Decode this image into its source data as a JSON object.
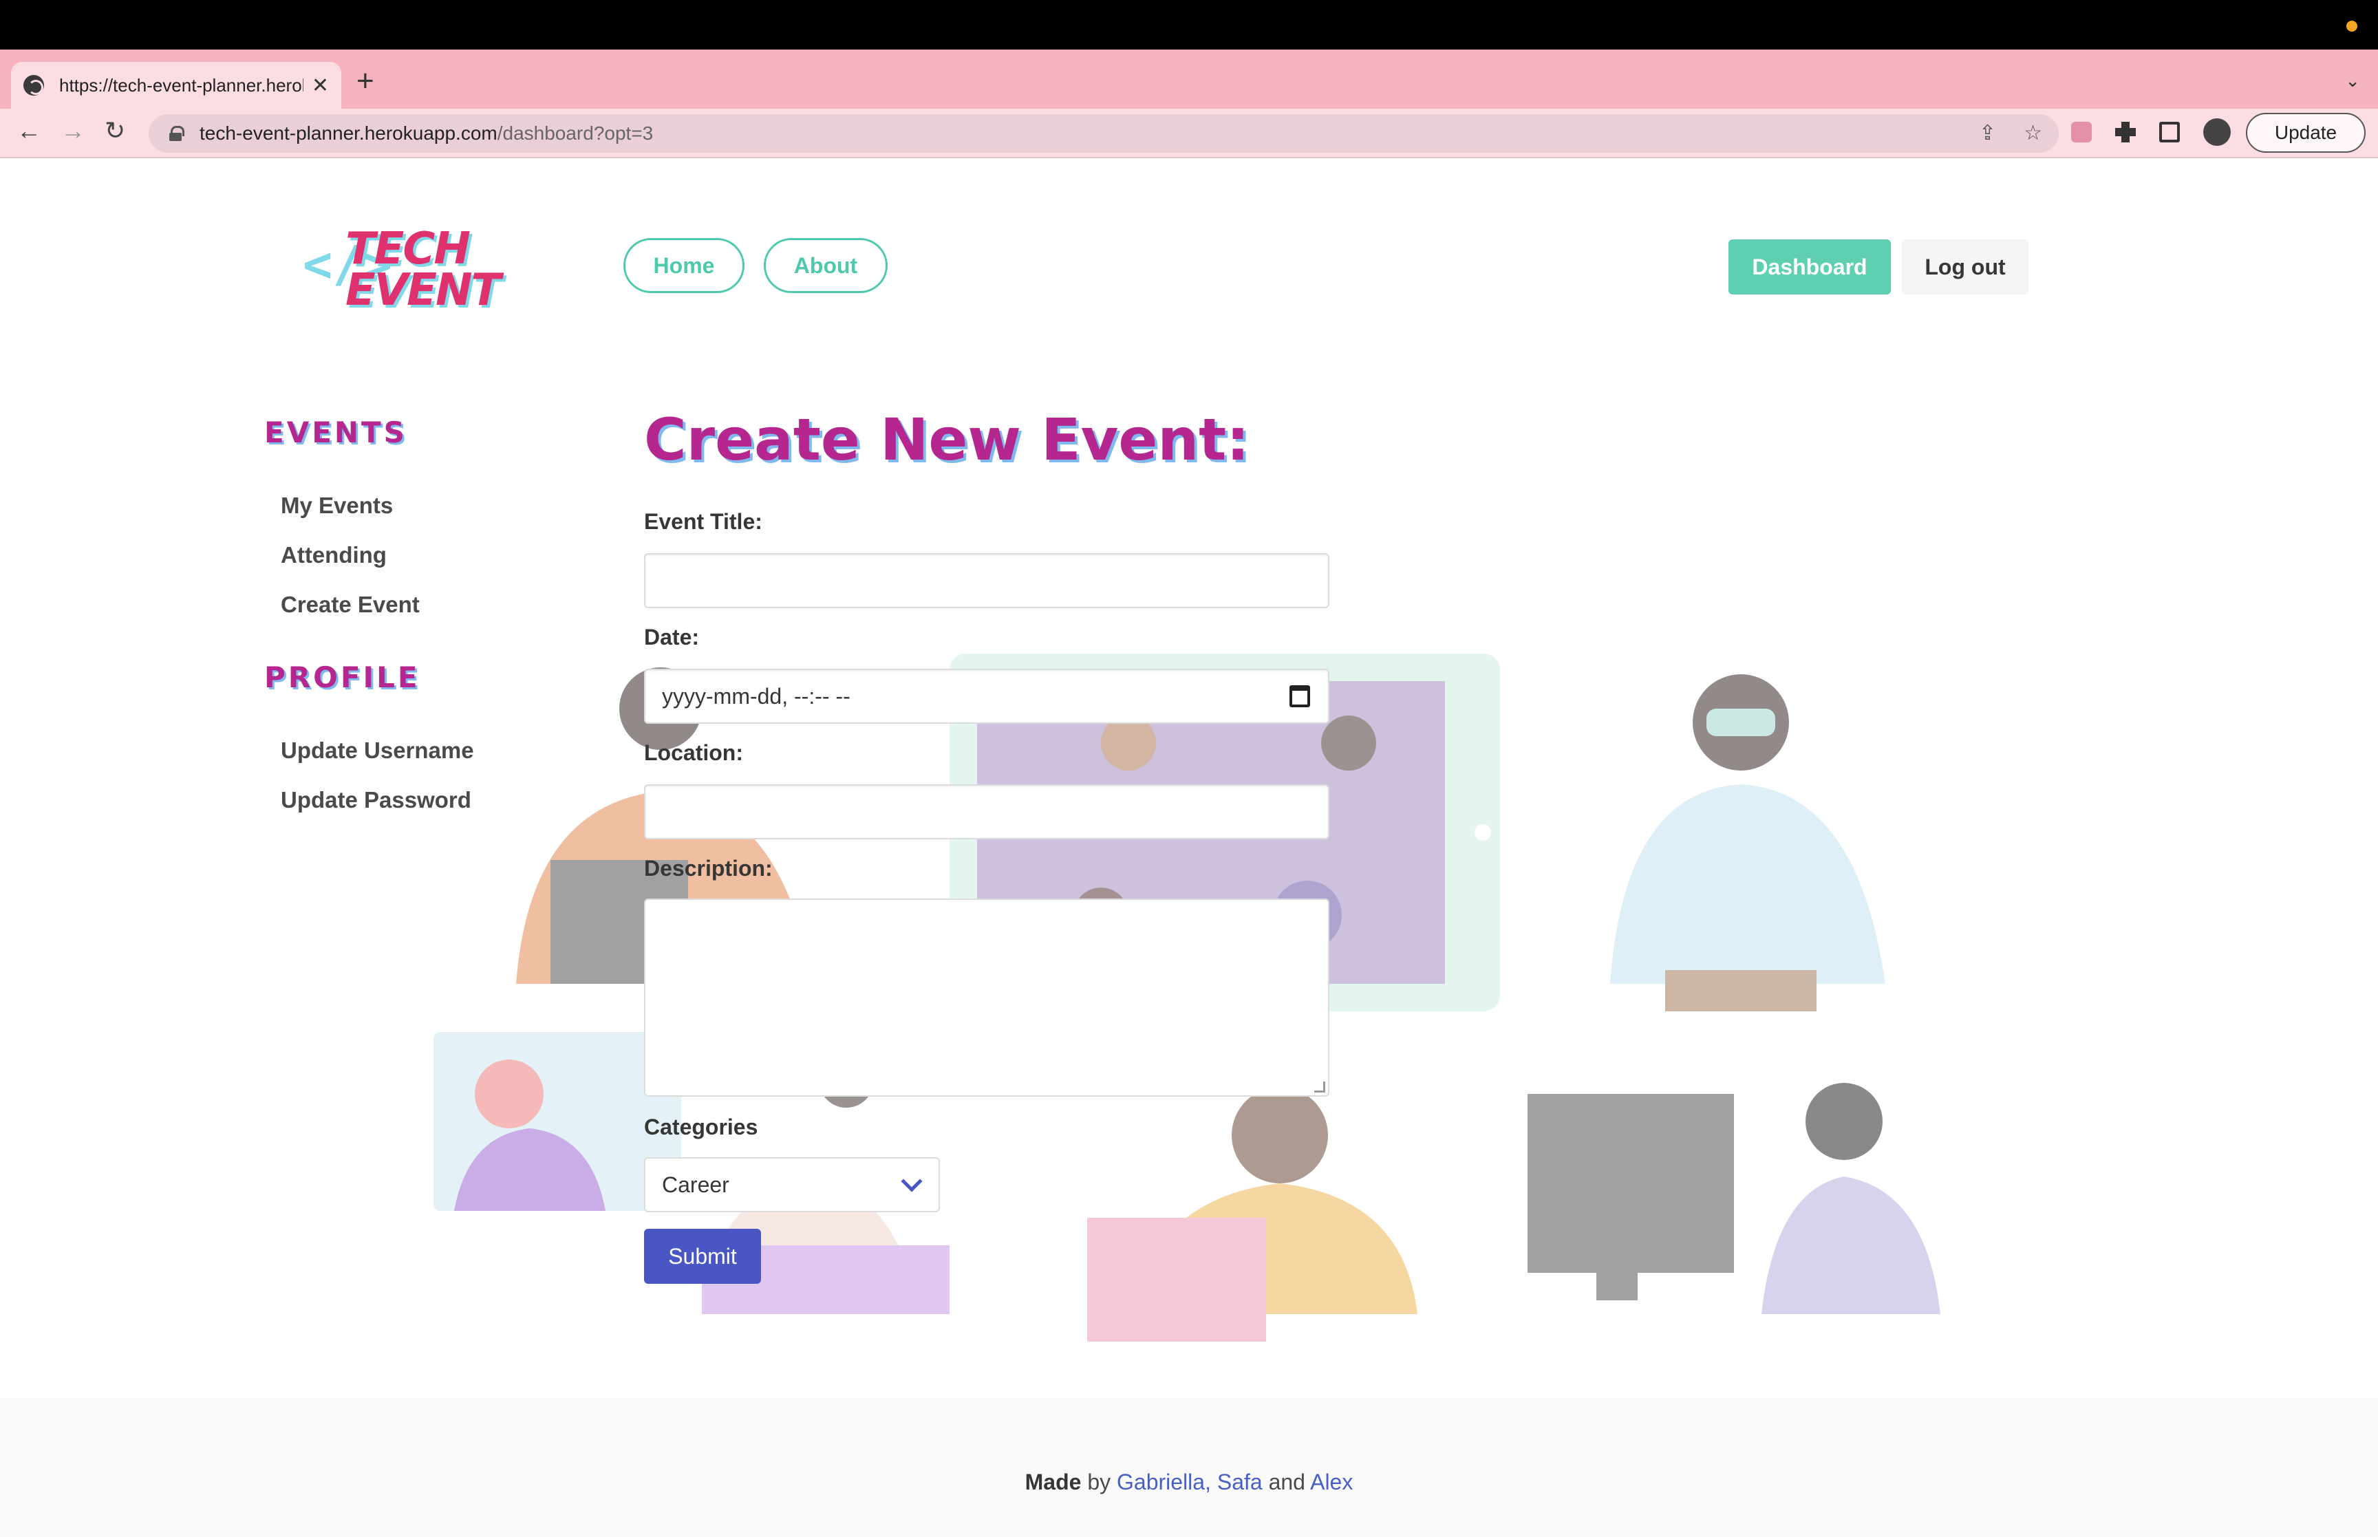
{
  "browser": {
    "tab_title": "https://tech-event-planner.herokuapp.com/dashboard?opt=3",
    "url_host": "tech-event-planner.herokuapp.com",
    "url_path": "/dashboard?opt=3",
    "update_label": "Update"
  },
  "header": {
    "logo_bracket": "</>",
    "logo_line1": "TECH",
    "logo_line2": "EVENT",
    "nav": [
      "Home",
      "About"
    ],
    "dashboard_label": "Dashboard",
    "logout_label": "Log out"
  },
  "sidebar": {
    "events_heading": "EVENTS",
    "events_links": [
      "My Events",
      "Attending",
      "Create Event"
    ],
    "profile_heading": "PROFILE",
    "profile_links": [
      "Update Username",
      "Update Password"
    ]
  },
  "form": {
    "title": "Create New Event:",
    "title_label": "Event Title:",
    "title_value": "",
    "date_label": "Date:",
    "date_placeholder": "yyyy-mm-dd, --:-- --",
    "location_label": "Location:",
    "location_value": "",
    "description_label": "Description:",
    "categories_label": "Categories",
    "category_selected": "Career",
    "submit_label": "Submit"
  },
  "footer": {
    "made": "Made",
    "by": "by",
    "author1": "Gabriella,",
    "author2": "Safa",
    "and": "and",
    "author3": "Alex"
  },
  "colors": {
    "accent_teal": "#5fcfb2",
    "heading_magenta": "#b5268f",
    "submit_blue": "#4a56c4",
    "tab_strip_pink": "#f5b3c0"
  }
}
